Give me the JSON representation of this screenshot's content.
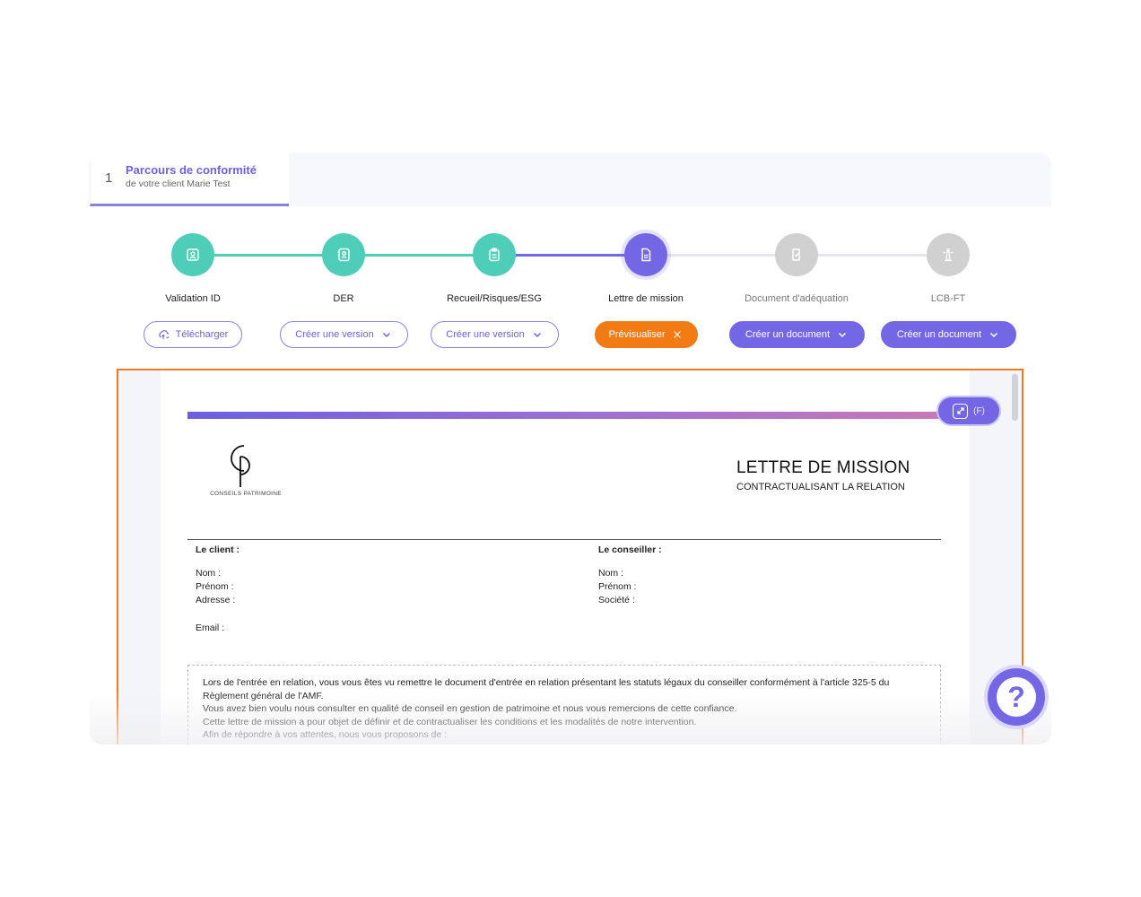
{
  "tab": {
    "number": "1",
    "title": "Parcours de conformité",
    "subtitle": "de votre client Marie Test"
  },
  "steps": [
    {
      "label": "Validation ID",
      "icon": "id-badge-icon",
      "state": "done",
      "button": {
        "label": "Télécharger",
        "style": "outline",
        "icon": "cloud-upload-icon"
      }
    },
    {
      "label": "DER",
      "icon": "contact-book-icon",
      "state": "done",
      "button": {
        "label": "Créer une version",
        "style": "outline",
        "icon": "chevron-down-icon"
      }
    },
    {
      "label": "Recueil/Risques/ESG",
      "icon": "clipboard-icon",
      "state": "done",
      "button": {
        "label": "Créer une version",
        "style": "outline",
        "icon": "chevron-down-icon"
      }
    },
    {
      "label": "Lettre de mission",
      "icon": "document-icon",
      "state": "active",
      "button": {
        "label": "Prévisualiser",
        "style": "orange",
        "icon": "close-icon"
      }
    },
    {
      "label": "Document d'adéquation",
      "icon": "document-check-icon",
      "state": "pending",
      "button": {
        "label": "Créer un document",
        "style": "purple",
        "icon": "chevron-down-icon"
      }
    },
    {
      "label": "LCB-FT",
      "icon": "lighthouse-icon",
      "state": "pending",
      "button": {
        "label": "Créer un document",
        "style": "purple",
        "icon": "chevron-down-icon"
      }
    }
  ],
  "colors": {
    "done": "#4ecdb8",
    "active": "#7467e6",
    "pending": "#d0d0d0",
    "accent_orange": "#f27b14"
  },
  "preview": {
    "expand_shortcut": "(F)",
    "logo_text": "CONSEILS PATRIMOINE",
    "title": "LETTRE DE MISSION",
    "subtitle": "CONTRACTUALISANT LA RELATION",
    "client": {
      "heading": "Le client :",
      "fields": [
        "Nom :",
        "Prénom :",
        "Adresse :"
      ],
      "email": "Email :"
    },
    "advisor": {
      "heading": "Le conseiller :",
      "fields": [
        "Nom :",
        "Prénom :",
        "Société :"
      ]
    },
    "paragraphs": [
      "Lors de l'entrée en relation, vous vous êtes vu remettre le document d'entrée en relation présentant les statuts légaux du conseiller conformément à l'article 325-5 du Règlement général de l'AMF.",
      "Vous avez bien voulu nous consulter en qualité de conseil en gestion de patrimoine et nous vous remercions de cette confiance.",
      "Cette lettre de mission a pour objet de définir et de contractualiser les conditions et les modalités de notre intervention.",
      "Afin de répondre à vos attentes, nous vous proposons de :"
    ]
  }
}
